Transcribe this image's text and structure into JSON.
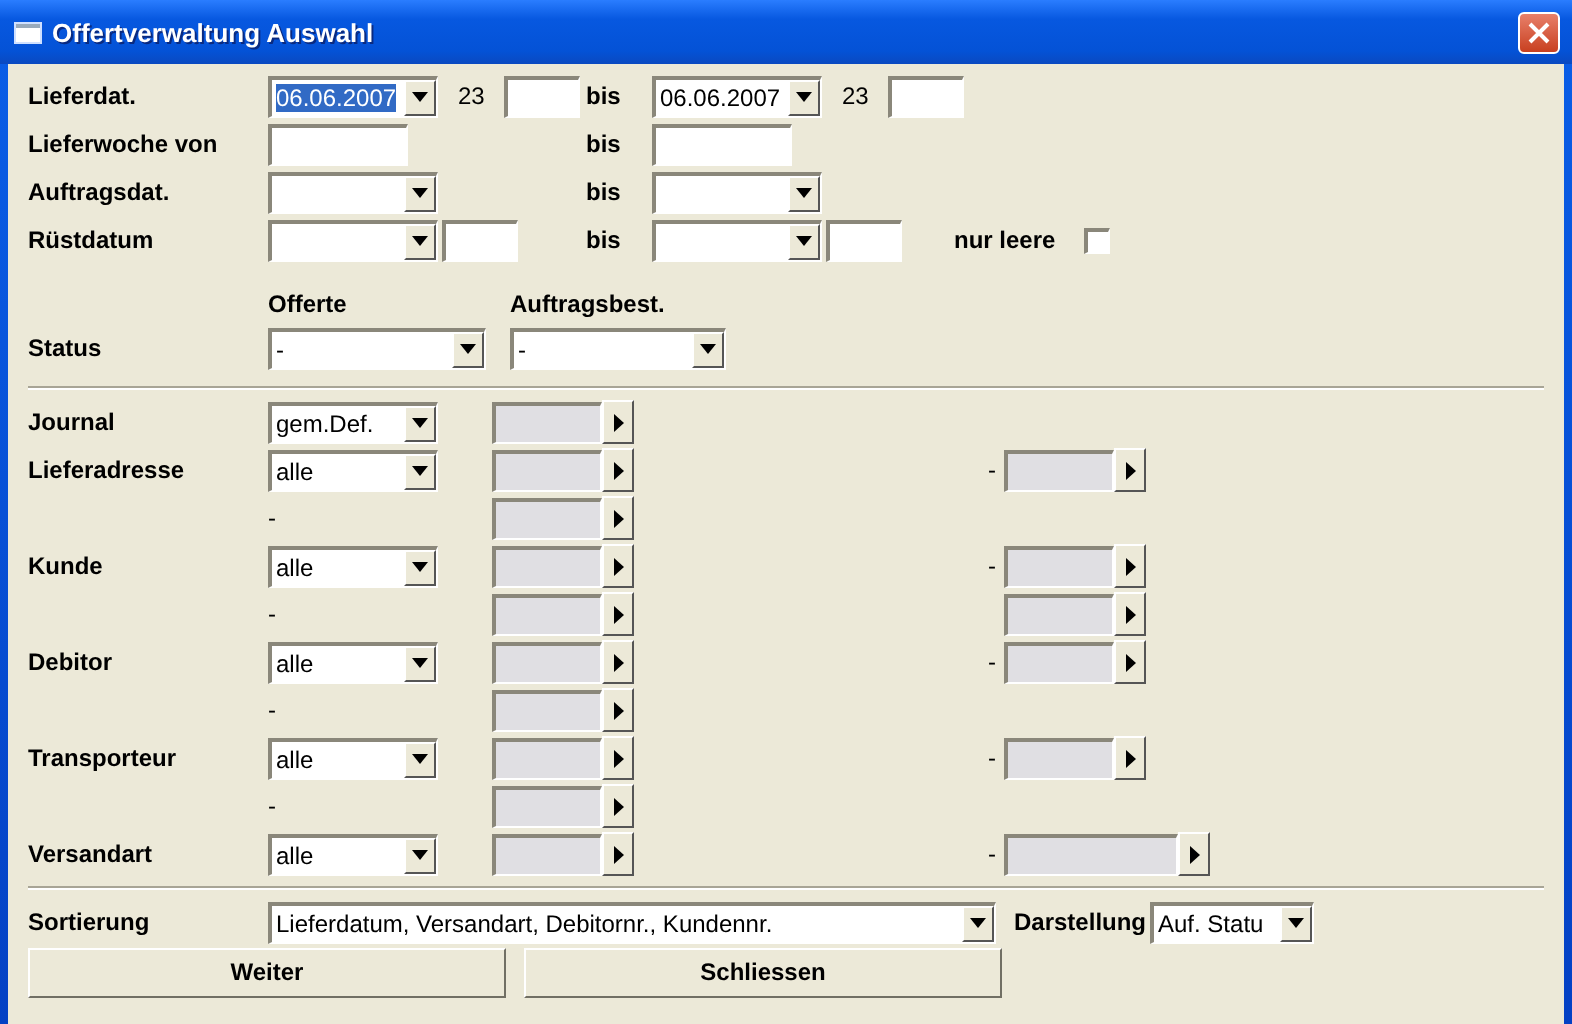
{
  "window": {
    "title": "Offertverwaltung Auswahl"
  },
  "date_rows": [
    {
      "label": "Lieferdat.",
      "kind": "date_time",
      "from_value": "06.06.2007",
      "from_highlighted": true,
      "from_time": "23",
      "to_label": "bis",
      "to_value": "06.06.2007",
      "to_time": "23"
    },
    {
      "label": "Lieferwoche von",
      "kind": "week",
      "to_label": "bis"
    },
    {
      "label": "Auftragsdat.",
      "kind": "date",
      "to_label": "bis"
    },
    {
      "label": "Rüstdatum",
      "kind": "date_extra",
      "to_label": "bis",
      "empty_only": {
        "label": "nur leere",
        "checked": false
      }
    }
  ],
  "status": {
    "columns": [
      "Offerte",
      "Auftragsbest."
    ],
    "label": "Status",
    "values": [
      "-",
      "-"
    ]
  },
  "filters": [
    {
      "kind": "main",
      "label": "Journal",
      "value": "gem.Def."
    },
    {
      "kind": "main",
      "label": "Lieferadresse",
      "value": "alle",
      "right": {
        "dash": "-",
        "wide": false
      }
    },
    {
      "kind": "sub",
      "dash": "-"
    },
    {
      "kind": "main",
      "label": "Kunde",
      "value": "alle",
      "right": {
        "dash": "-",
        "wide": false
      }
    },
    {
      "kind": "sub",
      "dash": "-",
      "right": {
        "wide": false
      }
    },
    {
      "kind": "main",
      "label": "Debitor",
      "value": "alle",
      "right": {
        "dash": "-",
        "wide": false
      }
    },
    {
      "kind": "sub",
      "dash": "-"
    },
    {
      "kind": "main",
      "label": "Transporteur",
      "value": "alle",
      "right": {
        "dash": "-",
        "wide": false
      }
    },
    {
      "kind": "sub",
      "dash": "-"
    },
    {
      "kind": "main",
      "label": "Versandart",
      "value": "alle",
      "right": {
        "dash": "-",
        "wide": true
      }
    }
  ],
  "sort": {
    "label": "Sortierung",
    "value": "Lieferdatum, Versandart, Debitornr., Kundennr.",
    "display_label": "Darstellung",
    "display_value": "Auf. Statu"
  },
  "buttons": [
    "Weiter",
    "Schliessen"
  ]
}
